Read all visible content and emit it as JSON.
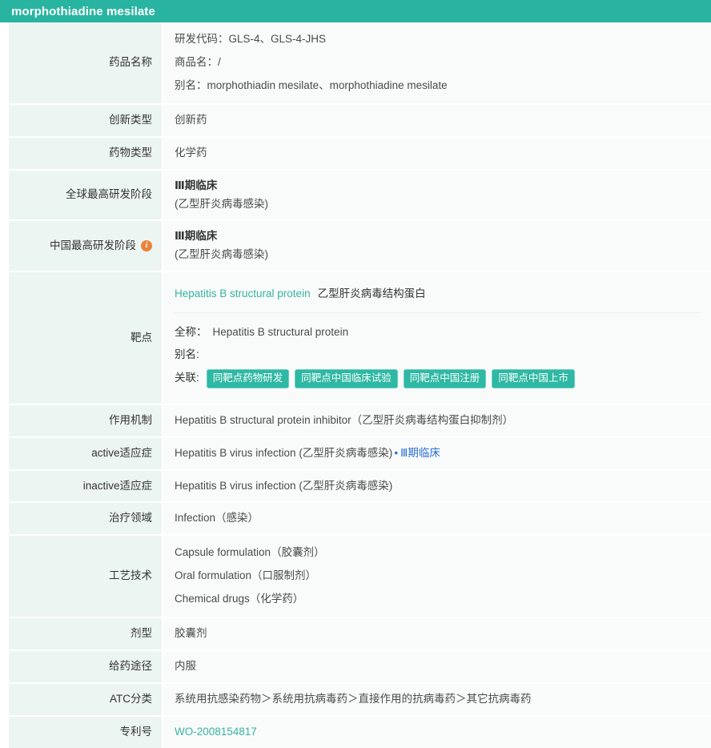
{
  "header": {
    "title": "morphothiadine mesilate"
  },
  "colors": {
    "brand_teal": "#28b4a0",
    "tag_teal": "#2fb8a4",
    "label_bg": "#edf5f3",
    "value_bg": "#f9fbfb",
    "info_orange": "#e8833a",
    "blue_link": "#2a6fd6",
    "teal_link": "#36b3a0"
  },
  "rows": {
    "drug_name": {
      "label": "药品名称",
      "lines": [
        "研发代码：GLS-4、GLS-4-JHS",
        "商品名：/",
        "别名：morphothiadin mesilate、morphothiadine mesilate"
      ]
    },
    "innovation_type": {
      "label": "创新类型",
      "value": "创新药"
    },
    "drug_type": {
      "label": "药物类型",
      "value": "化学药"
    },
    "global_stage": {
      "label": "全球最高研发阶段",
      "stage": "Ⅲ期临床",
      "indication": "(乙型肝炎病毒感染)"
    },
    "china_stage": {
      "label": "中国最高研发阶段",
      "info_icon": "info-icon",
      "stage": "Ⅲ期临床",
      "indication": "(乙型肝炎病毒感染)"
    },
    "target": {
      "label": "靶点",
      "name_en": "Hepatitis B structural protein",
      "name_cn": "乙型肝炎病毒结构蛋白",
      "fullname_key": "全称：",
      "fullname_value": "Hepatitis B structural protein",
      "alias_key": "别名:",
      "alias_value": "",
      "relation_key": "关联:",
      "tags": [
        "同靶点药物研发",
        "同靶点中国临床试验",
        "同靶点中国注册",
        "同靶点中国上市"
      ]
    },
    "mechanism": {
      "label": "作用机制",
      "value": "Hepatitis B structural protein inhibitor（乙型肝炎病毒结构蛋白抑制剂）"
    },
    "active_indication": {
      "label": "active适应症",
      "value": "Hepatitis B virus infection (乙型肝炎病毒感染)",
      "separator": "•",
      "stage_link": "Ⅲ期临床"
    },
    "inactive_indication": {
      "label": "inactive适应症",
      "value": "Hepatitis B virus infection (乙型肝炎病毒感染)"
    },
    "therapeutic_area": {
      "label": "治疗领域",
      "value": "Infection（感染）"
    },
    "technology": {
      "label": "工艺技术",
      "lines": [
        "Capsule formulation（胶囊剂）",
        "Oral formulation（口服制剂）",
        "Chemical drugs（化学药）"
      ]
    },
    "dosage_form": {
      "label": "剂型",
      "value": "胶囊剂"
    },
    "route": {
      "label": "给药途径",
      "value": "内服"
    },
    "atc": {
      "label": "ATC分类",
      "value": "系统用抗感染药物＞系统用抗病毒药＞直接作用的抗病毒药＞其它抗病毒药"
    },
    "patent": {
      "label": "专利号",
      "value": "WO-2008154817"
    }
  }
}
